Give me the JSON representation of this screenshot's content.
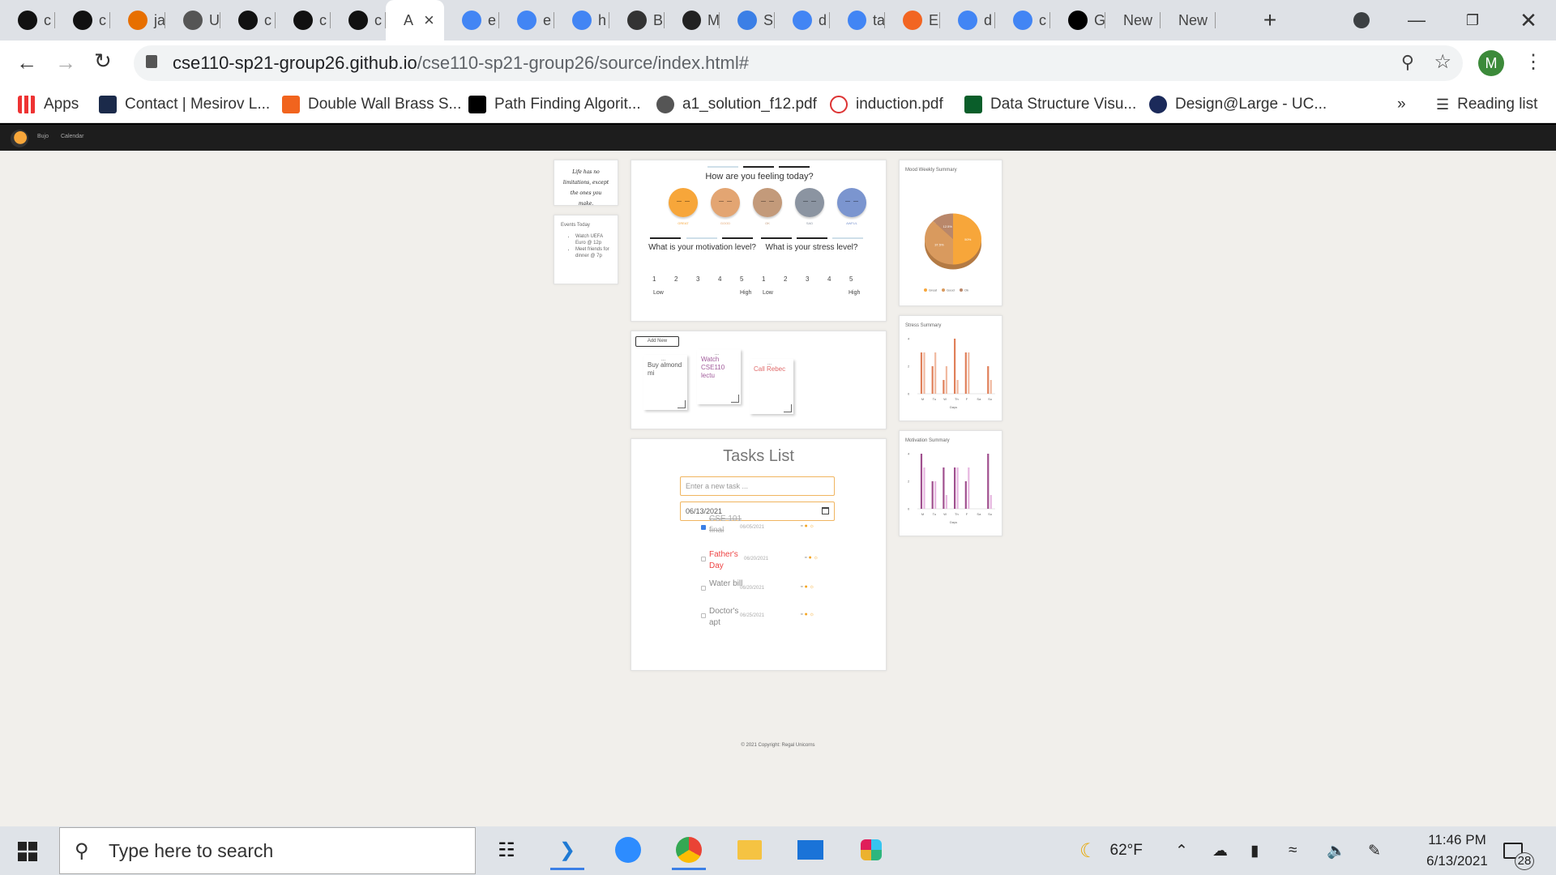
{
  "browser": {
    "tabs": [
      {
        "icon": "github-icon",
        "label": "c"
      },
      {
        "icon": "github-icon",
        "label": "c"
      },
      {
        "icon": "java-icon",
        "label": "ja"
      },
      {
        "icon": "globe-icon",
        "label": "U"
      },
      {
        "icon": "github-icon",
        "label": "c"
      },
      {
        "icon": "github-icon",
        "label": "c"
      },
      {
        "icon": "github-icon",
        "label": "c"
      },
      {
        "icon": "none",
        "label": "A"
      },
      {
        "icon": "google-icon",
        "label": "e"
      },
      {
        "icon": "google-icon",
        "label": "e"
      },
      {
        "icon": "google-icon",
        "label": "h"
      },
      {
        "icon": "markdown-icon",
        "label": "B"
      },
      {
        "icon": "film-icon",
        "label": "M"
      },
      {
        "icon": "target-icon",
        "label": "S"
      },
      {
        "icon": "google-icon",
        "label": "d"
      },
      {
        "icon": "google-icon",
        "label": "ta"
      },
      {
        "icon": "clock-icon",
        "label": "E"
      },
      {
        "icon": "google-icon",
        "label": "d"
      },
      {
        "icon": "google-icon",
        "label": "c"
      },
      {
        "icon": "medium-icon",
        "label": "G"
      },
      {
        "icon": "none",
        "label": "New"
      },
      {
        "icon": "none",
        "label": "New"
      }
    ],
    "new_tab": "+",
    "url_host": "cse110-sp21-group26.github.io",
    "url_path": "/cse110-sp21-group26/source/index.html#",
    "profile_initial": "M",
    "bookmarks": [
      "Apps",
      "Contact | Mesirov L...",
      "Double Wall Brass S...",
      "Path Finding Algorit...",
      "a1_solution_f12.pdf",
      "induction.pdf",
      "Data Structure Visu...",
      "Design@Large - UC..."
    ],
    "bookmarks_overflow": "»",
    "reading_list": "Reading list"
  },
  "site": {
    "nav": [
      "Bujo",
      "Calendar"
    ],
    "quote": "Life has no limitations, except the ones you make.",
    "events": {
      "title": "Events Today",
      "items": [
        "Watch UEFA Euro @ 12p",
        "Meet friends for dinner @ 7p"
      ]
    },
    "mood": {
      "question": "How are you feeling today?",
      "options": [
        {
          "label": "GREAT",
          "color": "#f7a63a"
        },
        {
          "label": "GOOD",
          "color": "#e3a572"
        },
        {
          "label": "OK",
          "color": "#c39a7a"
        },
        {
          "label": "SAD",
          "color": "#8b94a1"
        },
        {
          "label": "AWFUL",
          "color": "#7b95cf"
        }
      ]
    },
    "motivation": {
      "question": "What is your motivation level?",
      "scale": [
        "1",
        "2",
        "3",
        "4",
        "5"
      ],
      "low": "Low",
      "high": "High"
    },
    "stress": {
      "question": "What is your stress level?",
      "scale": [
        "1",
        "2",
        "3",
        "4",
        "5"
      ],
      "low": "Low",
      "high": "High"
    },
    "notes": {
      "add_label": "Add New",
      "items": [
        {
          "text": "Buy almond mi",
          "color": "#22f0ea",
          "dots": "..."
        },
        {
          "text": "Watch CSE110 lectu",
          "color": "#f7a0f3",
          "dots": "..."
        },
        {
          "text": "Call Rebec",
          "color": "#f78ee8",
          "dots": "..."
        }
      ]
    },
    "tasks": {
      "title": "Tasks List",
      "input_placeholder": "Enter a new task ...",
      "date_value": "06/13/2021",
      "items": [
        {
          "name": "CSE 101 final",
          "date": "06/05/2021",
          "done": true,
          "holiday": false
        },
        {
          "name": "Father's Day",
          "date": "06/20/2021",
          "done": false,
          "holiday": true
        },
        {
          "name": "Water bill",
          "date": "06/20/2021",
          "done": false,
          "holiday": false
        },
        {
          "name": "Doctor's apt",
          "date": "06/25/2021",
          "done": false,
          "holiday": false
        }
      ]
    },
    "footer": "© 2021 Copyright: Regal Unicorns"
  },
  "chart_data": [
    {
      "type": "pie",
      "title": "Mood Weekly Summary",
      "categories": [
        "Great",
        "Good",
        "Ok"
      ],
      "values": [
        50,
        37.5,
        12.5
      ],
      "slice_labels": [
        "50%",
        "37.5%",
        "12.5%"
      ],
      "colors": [
        "#f7a63a",
        "#d99a5e",
        "#b9876a"
      ],
      "legend": "bottom"
    },
    {
      "type": "bar",
      "title": "Stress Summary",
      "categories": [
        "M",
        "Tu",
        "W",
        "Th",
        "F",
        "Sa",
        "Su"
      ],
      "series": [
        {
          "values": [
            3,
            2,
            1,
            4,
            3,
            0,
            2
          ]
        },
        {
          "values": [
            3,
            3,
            2,
            1,
            3,
            0,
            1
          ]
        }
      ],
      "colors": [
        "#e0805a",
        "#f0b9a0"
      ],
      "xlabel": "Days",
      "yticks": [
        "0",
        "2",
        "4"
      ],
      "ylim": [
        0,
        4
      ]
    },
    {
      "type": "bar",
      "title": "Motivation Summary",
      "categories": [
        "M",
        "Tu",
        "W",
        "Th",
        "F",
        "Sa",
        "Su"
      ],
      "series": [
        {
          "values": [
            4,
            2,
            3,
            3,
            2,
            0,
            4
          ]
        },
        {
          "values": [
            3,
            2,
            1,
            3,
            3,
            0,
            1
          ]
        }
      ],
      "colors": [
        "#a0508f",
        "#e7b7e0"
      ],
      "xlabel": "Days",
      "yticks": [
        "0",
        "2",
        "4"
      ],
      "ylim": [
        0,
        4
      ]
    }
  ],
  "taskbar": {
    "search_placeholder": "Type here to search",
    "weather": "62°F",
    "time": "11:46 PM",
    "date": "6/13/2021",
    "notification_count": "28"
  }
}
